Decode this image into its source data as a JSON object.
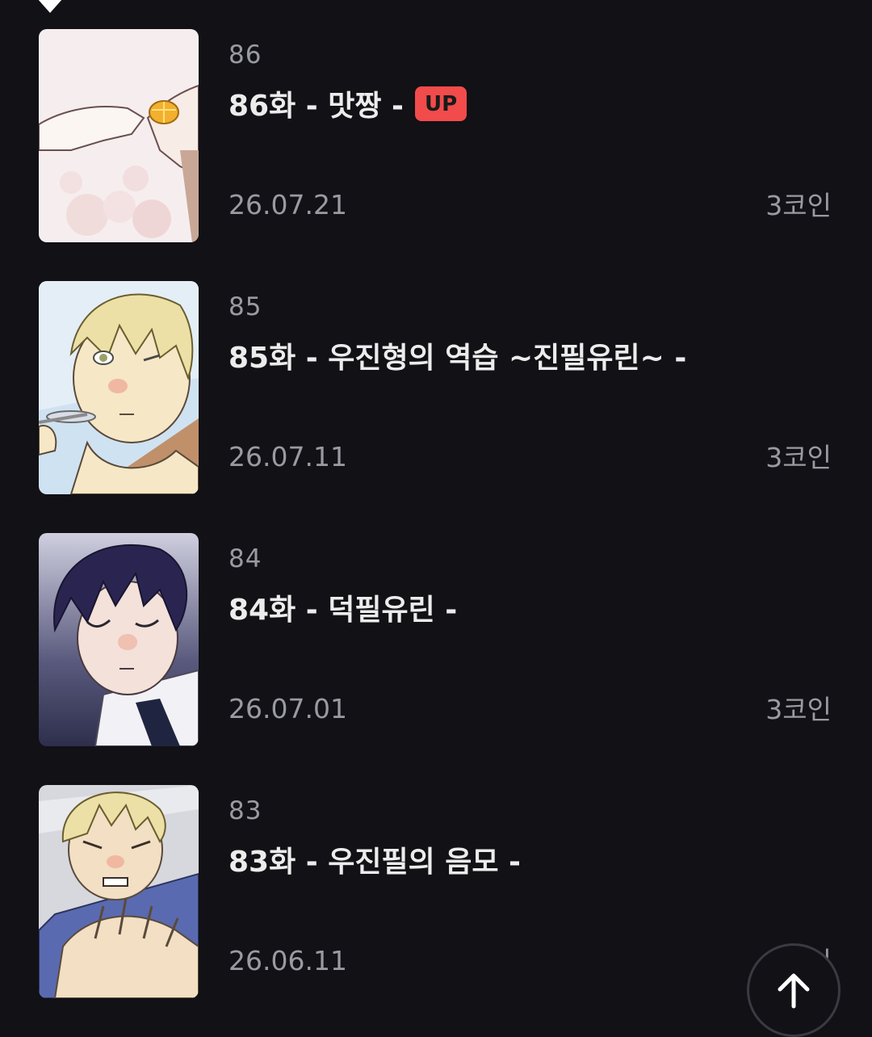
{
  "episodes": [
    {
      "number": "86",
      "title": "86화 - 맛짱 -",
      "badge": "UP",
      "date": "26.07.21",
      "price": "3코인"
    },
    {
      "number": "85",
      "title": "85화 - 우진형의 역습 ~진필유린~ -",
      "badge": "",
      "date": "26.07.11",
      "price": "3코인"
    },
    {
      "number": "84",
      "title": "84화 - 덕필유린 -",
      "badge": "",
      "date": "26.07.01",
      "price": "3코인"
    },
    {
      "number": "83",
      "title": "83화 - 우진필의 음모 -",
      "badge": "",
      "date": "26.06.11",
      "price": "3코인"
    }
  ],
  "colors": {
    "background": "#111116",
    "badge_up": "#f24b4b",
    "muted_text": "#9a9aa2"
  },
  "icons": {
    "scroll_top": "arrow-up-icon",
    "selected_marker": "triangle-down-icon"
  }
}
